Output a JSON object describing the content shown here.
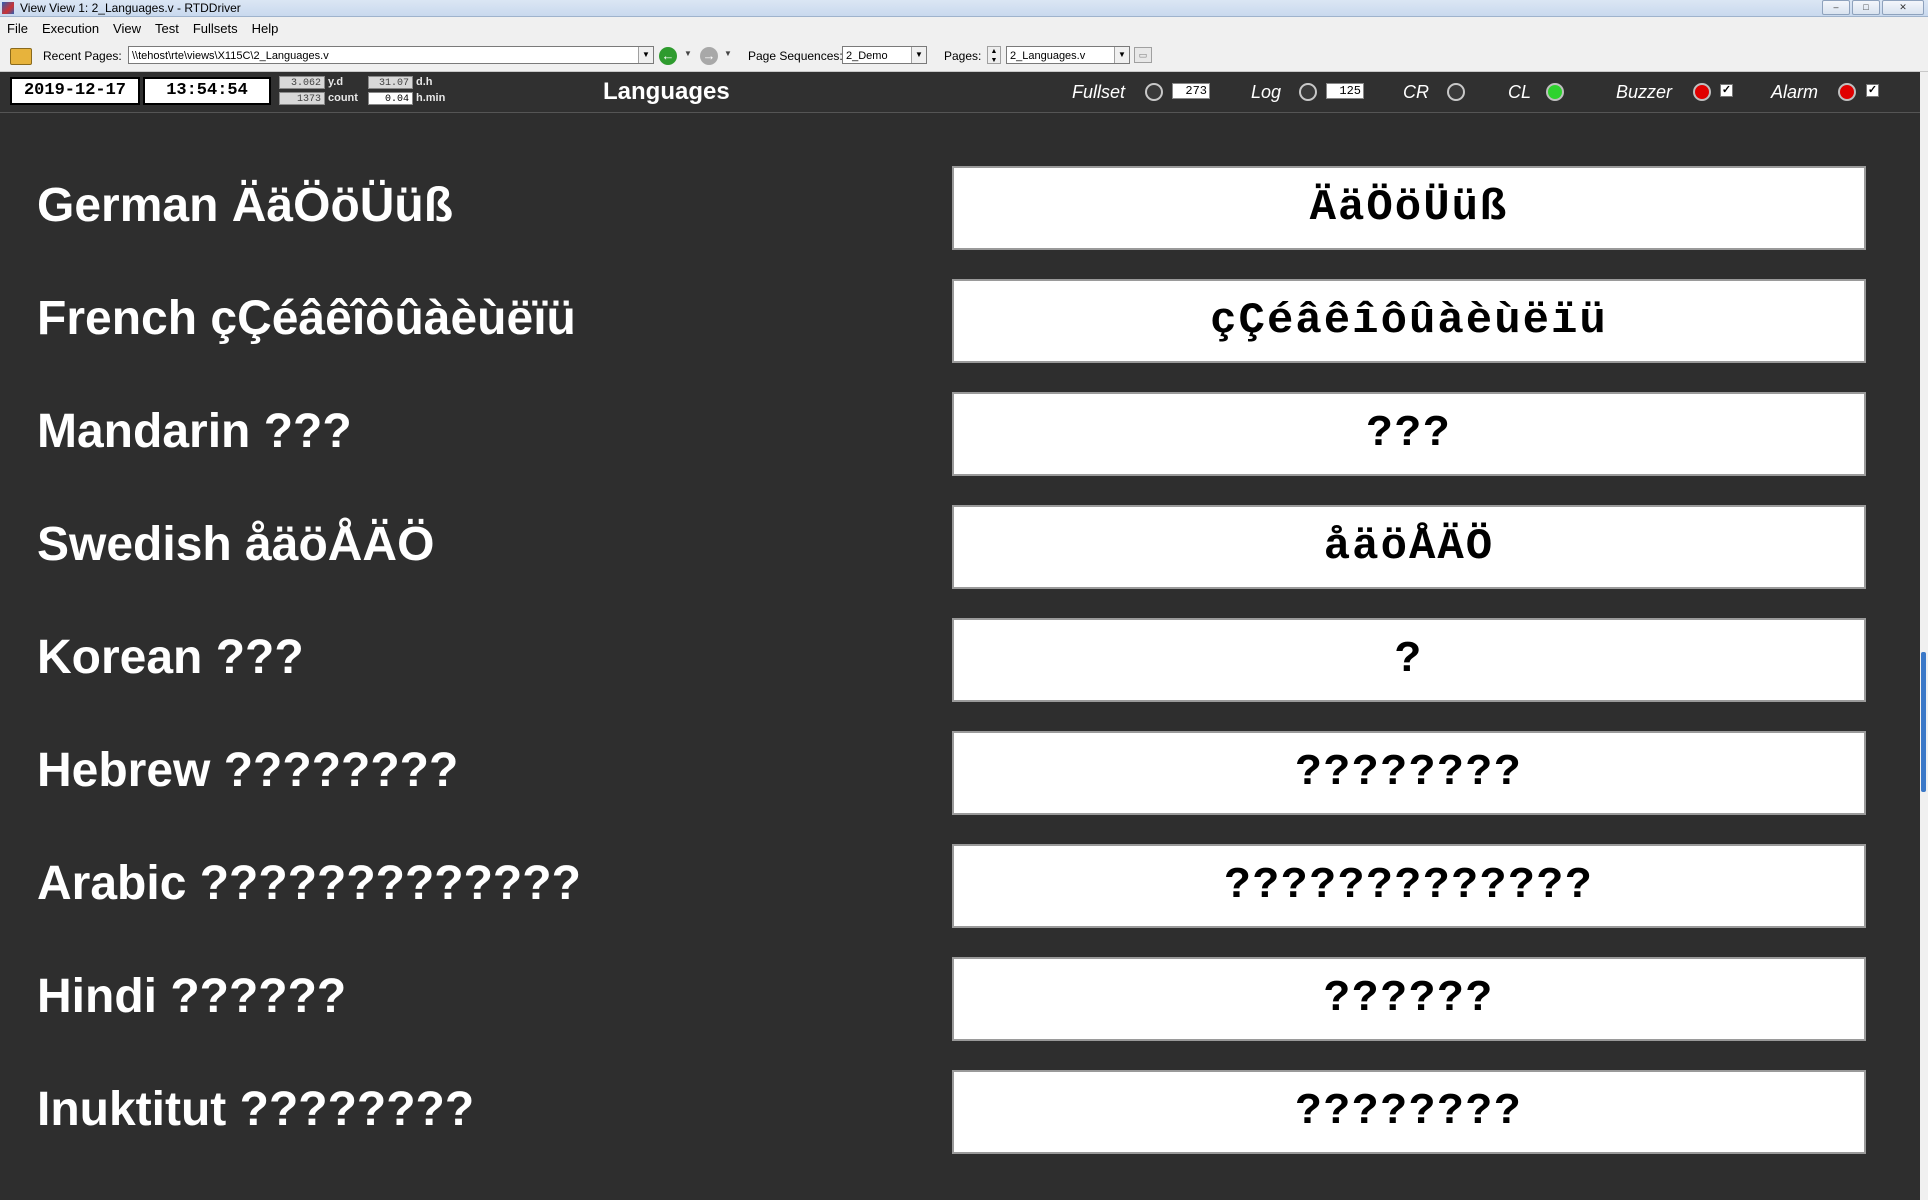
{
  "window": {
    "title": "View View 1: 2_Languages.v - RTDDriver",
    "app_icon": "rtddriver-app-icon"
  },
  "menu": [
    "File",
    "Execution",
    "View",
    "Test",
    "Fullsets",
    "Help"
  ],
  "toolbar": {
    "recent_pages_label": "Recent Pages:",
    "recent_pages_value": "\\\\tehost\\rte\\views\\X115C\\2_Languages.v",
    "page_sequences_label": "Page Sequences:",
    "page_sequences_value": "2_Demo",
    "pages_label": "Pages:",
    "pages_value": "2_Languages.v"
  },
  "status": {
    "date": "2019-12-17",
    "time": "13:54:54",
    "metrics": [
      {
        "value": "3.062",
        "unit": "y.d"
      },
      {
        "value": "1373",
        "unit": "count"
      },
      {
        "value": "31.07",
        "unit": "d.h"
      },
      {
        "value": "0.04",
        "unit": "h.min"
      }
    ],
    "page_title": "Languages",
    "indicators": {
      "fullset": {
        "label": "Fullset",
        "state": "off",
        "count": "273"
      },
      "log": {
        "label": "Log",
        "state": "off",
        "count": "125"
      },
      "cr": {
        "label": "CR",
        "state": "off"
      },
      "cl": {
        "label": "CL",
        "state": "on",
        "color": "#2fd22f"
      },
      "buzzer": {
        "label": "Buzzer",
        "state": "alarm",
        "color": "#e00000",
        "checked": "✓"
      },
      "alarm": {
        "label": "Alarm",
        "state": "alarm",
        "color": "#e00000",
        "checked": "✓"
      }
    }
  },
  "languages": [
    {
      "label": "German ÄäÖöÜüß",
      "value": "ÄäÖöÜüß"
    },
    {
      "label": "French çÇéâêîôûàèùëïü",
      "value": "çÇéâêîôûàèùëïü"
    },
    {
      "label": "Mandarin ???",
      "value": "???"
    },
    {
      "label": "Swedish åäöÅÄÖ",
      "value": "åäöÅÄÖ"
    },
    {
      "label": "Korean ???",
      "value": "?"
    },
    {
      "label": "Hebrew ????????",
      "value": "????????"
    },
    {
      "label": "Arabic ?????????????",
      "value": "?????????????"
    },
    {
      "label": "Hindi ??????",
      "value": "??????"
    },
    {
      "label": "Inuktitut ????????",
      "value": "????????"
    }
  ],
  "colors": {
    "background": "#2e2e2e",
    "label_text": "#ffffff",
    "value_box": "#ffffff",
    "led_green": "#2fd22f",
    "led_red": "#e00000"
  }
}
